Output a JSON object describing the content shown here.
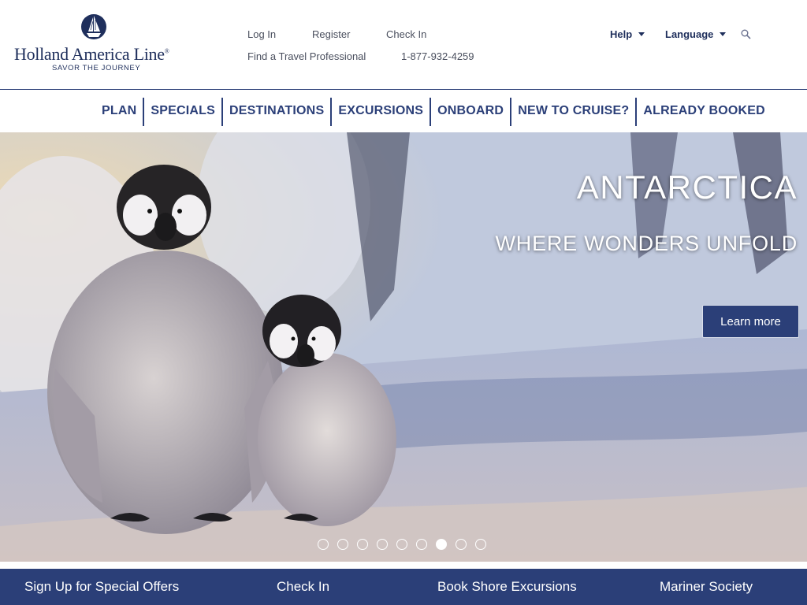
{
  "brand": {
    "name": "Holland America Line",
    "tagline": "SAVOR THE JOURNEY",
    "registered_mark": "®"
  },
  "utility": {
    "log_in": "Log In",
    "register": "Register",
    "check_in": "Check In",
    "find_agent": "Find a Travel Professional",
    "phone": "1-877-932-4259",
    "help": "Help",
    "language": "Language",
    "search_icon": "search-icon"
  },
  "nav": {
    "items": [
      "PLAN",
      "SPECIALS",
      "DESTINATIONS",
      "EXCURSIONS",
      "ONBOARD",
      "NEW TO CRUISE?",
      "ALREADY BOOKED"
    ]
  },
  "hero": {
    "title": "ANTARCTICA",
    "subtitle": "WHERE WONDERS UNFOLD",
    "cta": "Learn more",
    "slide_count": 9,
    "active_slide": 7
  },
  "bottom_bar": {
    "items": [
      "Sign Up for Special Offers",
      "Check In",
      "Book Shore Excursions",
      "Mariner Society"
    ]
  },
  "colors": {
    "brand_navy": "#2b3f78",
    "text_gray": "#4a4f5e",
    "white": "#ffffff"
  }
}
